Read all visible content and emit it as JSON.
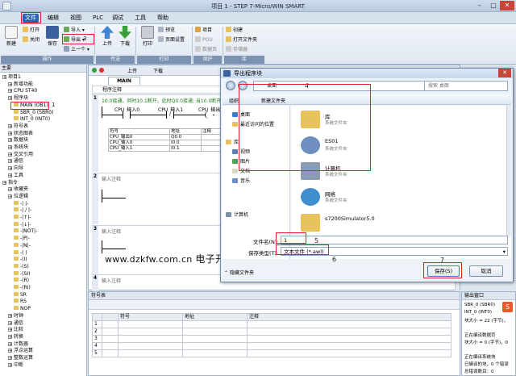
{
  "window": {
    "title": "项目 1 - STEP 7-Micro/WIN SMART"
  },
  "menu": [
    "文件",
    "编辑",
    "视图",
    "PLC",
    "调试",
    "工具",
    "帮助"
  ],
  "ribbon": {
    "new_label": "新建",
    "open_label": "打开",
    "close_label": "关闭",
    "save_label": "保存",
    "import_label": "导入",
    "export_label": "导出",
    "prev_label": "上一个",
    "upload_label": "上传",
    "download_label": "下载",
    "print_label": "打印",
    "preview_label": "预览",
    "page_setup_label": "页面设置",
    "project_label": "项目",
    "pou_label": "POU",
    "data_page_label": "数据页",
    "create_label": "创建",
    "open_folder_label": "打开文件夹",
    "memory_card_label": "存储器",
    "groups": [
      "操作",
      "传送",
      "打印",
      "保护",
      "库"
    ]
  },
  "annotations": {
    "n1": "1",
    "n2": "2",
    "n3": "3",
    "n4": "4",
    "n5": "5",
    "n6": "6",
    "n7": "7"
  },
  "leftpane": {
    "header": "主要",
    "items": [
      "项目1",
      "新增功能",
      "CPU ST40",
      "程序块",
      "MAIN (OB1)",
      "SBR_0 (SBR0)",
      "INT_0 (INT0)",
      "符号表",
      "状态图表",
      "数据块",
      "系统块",
      "交叉引用",
      "通信",
      "向导",
      "工具",
      "指令",
      "收藏夹",
      "位逻辑",
      "-|  |-",
      "-| / |-",
      "-|↑|-",
      "-|↓|-",
      "-|NOT|-",
      "-|P|-",
      "-|N|-",
      "-( )",
      "-(I)",
      "-(S)",
      "-(SI)",
      "-(R)",
      "-(RI)",
      "SR",
      "RS",
      "NOP",
      "时钟",
      "通信",
      "比较",
      "转换",
      "计数器",
      "浮点运算",
      "整数运算",
      "中断"
    ]
  },
  "editor": {
    "tab": "MAIN",
    "up_label": "上传",
    "down_label": "下载",
    "program_comment": "程序注释",
    "network1_comment": "10.0接通，同时10.1断开，此时Q0.0接通; 当10.0断开...",
    "contacts": [
      "CPU_输入0",
      "CPU_输入1",
      "CPU_输出0"
    ],
    "symbol_table": {
      "headers": [
        "符号",
        "地址",
        "注释"
      ],
      "rows": [
        [
          "CPU_输出0",
          "Q0.0",
          ""
        ],
        [
          "CPU_输入0",
          "I0.0",
          ""
        ],
        [
          "CPU_输入1",
          "I0.1",
          ""
        ]
      ]
    },
    "net_comment": "输入注释",
    "networks": [
      "1",
      "2",
      "3",
      "4"
    ]
  },
  "symbols_pane": {
    "title": "符号表",
    "headers": [
      "",
      "",
      "符号",
      "地址",
      "注释"
    ],
    "rows": [
      "1",
      "2",
      "3",
      "4",
      "5"
    ]
  },
  "output_pane": {
    "title": "输出窗口",
    "lines": [
      "SBR_0 (SBR0)",
      "INT_0 (INT0)",
      "块大小 = 22 (字节)，",
      "",
      "正在编译数据页",
      "块大小 = 0 (字节)，0",
      "",
      "正在编译系统块",
      "已编译的块，0 个错误",
      "总错误数目：0"
    ]
  },
  "dialog": {
    "title": "导出程序块",
    "address": "桌面",
    "search_placeholder": "搜索 桌面",
    "organize": "组织",
    "new_folder": "新建文件夹",
    "nav": [
      "桌面",
      "最近访问的位置",
      "库",
      "视频",
      "图片",
      "文档",
      "音乐",
      "计算机"
    ],
    "files": [
      {
        "name": "库",
        "type": "系统文件夹"
      },
      {
        "name": "ES01",
        "type": "系统文件夹"
      },
      {
        "name": "计算机",
        "type": "系统文件夹"
      },
      {
        "name": "网络",
        "type": "系统文件夹"
      },
      {
        "name": "s7200Simulator5.0",
        "type": ""
      }
    ],
    "filename_label": "文件名(N):",
    "filename_value": "1",
    "filetype_label": "保存类型(T):",
    "filetype_value": "文本文件 (*.awl)",
    "hide_folders": "隐藏文件夹",
    "save_label": "保存(S)",
    "cancel_label": "取消"
  },
  "watermark": {
    "url": "www.dzkfw.com.cn",
    "site": "电子开发网"
  },
  "colors": {
    "accent": "#2d63b5",
    "highlight": "#e0202a"
  }
}
